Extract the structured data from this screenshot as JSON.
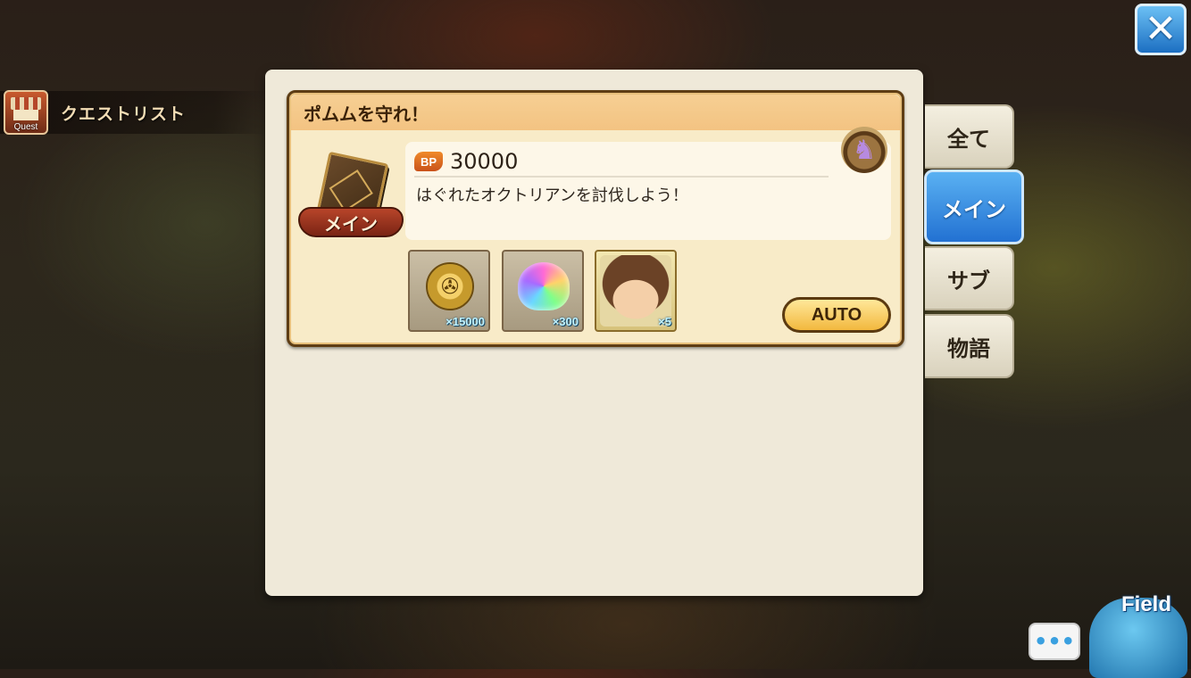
{
  "quest_bar": {
    "icon_label": "Quest",
    "title": "クエストリスト"
  },
  "close_button": {
    "glyph": "✕"
  },
  "quest_card": {
    "title": "ポムムを守れ！",
    "category_ribbon": "メイン",
    "bp_badge": "BP",
    "bp_value": "30000",
    "description": "はぐれたオクトリアンを討伐しよう！",
    "rewards": [
      {
        "icon": "gold-coin-icon",
        "count": "×15000"
      },
      {
        "icon": "rainbow-gem-icon",
        "count": "×300"
      },
      {
        "icon": "character-portrait-icon",
        "count": "×5"
      }
    ],
    "auto_label": "AUTO"
  },
  "tabs": [
    {
      "label": "全て",
      "active": false
    },
    {
      "label": "メイン",
      "active": true
    },
    {
      "label": "サブ",
      "active": false
    },
    {
      "label": "物語",
      "active": false
    }
  ],
  "bottom": {
    "chat_glyph": "•••",
    "field_label": "Field"
  },
  "colors": {
    "accent_blue": "#2271d2",
    "card_bg": "#f8ebc8",
    "panel_bg": "#efe9d9"
  }
}
